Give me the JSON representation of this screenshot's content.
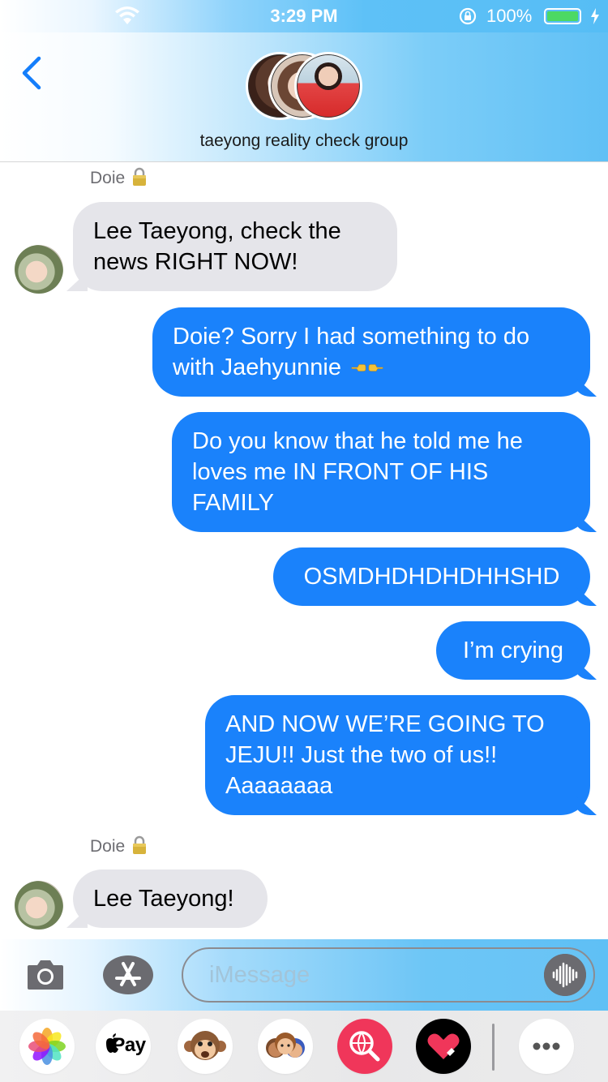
{
  "status_bar": {
    "time": "3:29 PM",
    "battery_percent": "100%",
    "battery_level": 1.0,
    "icons": [
      "wifi-icon",
      "rotation-lock-icon",
      "battery-icon",
      "charging-bolt-icon"
    ]
  },
  "header": {
    "group_name": "taeyong reality check group",
    "back_icon": "chevron-left-icon"
  },
  "messages": [
    {
      "sender": "Doie",
      "direction": "in",
      "text": "Lee Taeyong, check the news RIGHT NOW!"
    },
    {
      "direction": "out",
      "text": "Doie? Sorry I had something to do with Jaehyunnie",
      "emoji": "pointing-hands-emoji"
    },
    {
      "direction": "out",
      "text": "Do you know that he told me he loves me IN FRONT OF HIS FAMILY"
    },
    {
      "direction": "out",
      "text": "OSMDHDHDHDHHSHD"
    },
    {
      "direction": "out",
      "text": "I’m crying"
    },
    {
      "direction": "out",
      "text": "AND NOW WE’RE GOING TO JEJU!! Just the two of us!! Aaaaaaaa"
    },
    {
      "sender": "Doie",
      "direction": "in",
      "text": "Lee Taeyong!"
    }
  ],
  "composer": {
    "placeholder": "iMessage",
    "camera_icon": "camera-icon",
    "app_store_icon": "app-store-icon",
    "audio_icon": "audio-waveform-icon"
  },
  "app_drawer": {
    "apple_pay_label": "Pay",
    "apps": [
      "photos-icon",
      "apple-pay-icon",
      "monkey-animoji-icon",
      "memoji-stickers-icon",
      "web-search-icon",
      "digital-touch-heart-icon",
      "more-apps-icon"
    ]
  },
  "colors": {
    "outgoing_bubble": "#1a82fb",
    "incoming_bubble": "#e5e5ea",
    "accent": "#147efb"
  }
}
